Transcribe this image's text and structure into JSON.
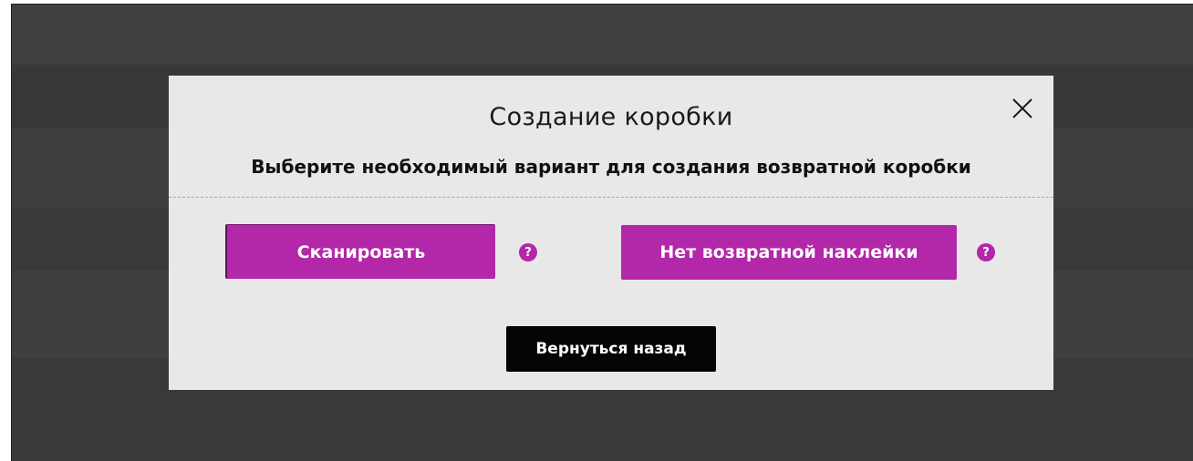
{
  "modal": {
    "title": "Создание коробки",
    "subtitle": "Выберите необходимый вариант для создания возвратной коробки",
    "close_icon": "close-icon",
    "scan_label": "Сканировать",
    "no_label_label": "Нет возвратной наклейки",
    "help_glyph": "?",
    "back_label": "Вернуться назад"
  },
  "colors": {
    "overlay": "#3b3b3b",
    "modal_bg": "#e8e8e8",
    "accent": "#b327a9",
    "back_button": "#050505"
  }
}
